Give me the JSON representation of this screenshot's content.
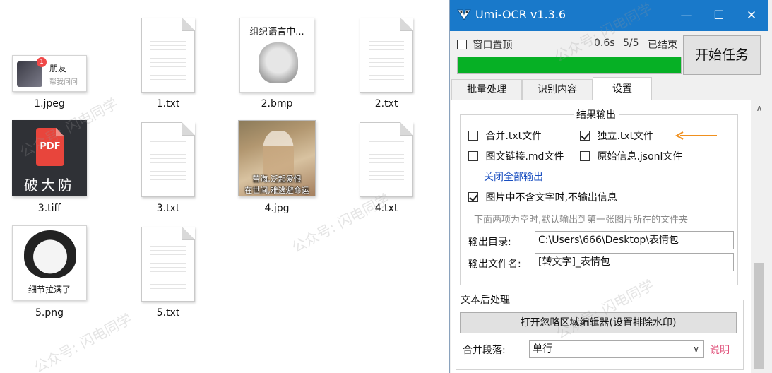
{
  "explorer": {
    "files": [
      {
        "name": "1.jpeg",
        "thumb_kind": "image",
        "thumb_text": "朋友",
        "thumb_subtext": "帮我问问",
        "badge": "1"
      },
      {
        "name": "1.txt",
        "thumb_kind": "text-document"
      },
      {
        "name": "2.bmp",
        "thumb_kind": "image",
        "thumb_text": "组织语言中..."
      },
      {
        "name": "2.txt",
        "thumb_kind": "text-document"
      },
      {
        "name": "3.tiff",
        "thumb_kind": "image",
        "thumb_badge": "PDF",
        "thumb_text": "破大防"
      },
      {
        "name": "3.txt",
        "thumb_kind": "text-document"
      },
      {
        "name": "4.jpg",
        "thumb_kind": "image",
        "thumb_text_1": "苦海,泛起爱恨",
        "thumb_text_2": "在世间,难逃避命运"
      },
      {
        "name": "4.txt",
        "thumb_kind": "text-document"
      },
      {
        "name": "5.png",
        "thumb_kind": "image",
        "thumb_text": "细节拉满了"
      },
      {
        "name": "5.txt",
        "thumb_kind": "text-document"
      }
    ],
    "watermark": "公众号: 闪电同学"
  },
  "ocr_window": {
    "title": "Umi-OCR v1.3.6",
    "controls": {
      "minimize": "—",
      "maximize": "☐",
      "close": "✕"
    },
    "topbar": {
      "pin_label": "窗口置顶",
      "pin_checked": false,
      "elapsed": "0.6s",
      "count": "5/5",
      "status": "已结束",
      "start_button": "开始任务",
      "progress": 1.0,
      "progress_color": "#06b025"
    },
    "tabs": [
      {
        "label": "批量处理",
        "active": false
      },
      {
        "label": "识别内容",
        "active": false
      },
      {
        "label": "设置",
        "active": true
      }
    ],
    "settings": {
      "result_output": {
        "legend": "结果输出",
        "merged_txt": {
          "label": "合并.txt文件",
          "checked": false
        },
        "separate_txt": {
          "label": "独立.txt文件",
          "checked": true
        },
        "md_link": {
          "label": "图文链接.md文件",
          "checked": false
        },
        "jsonl": {
          "label": "原始信息.jsonl文件",
          "checked": false
        },
        "close_all_link": "关闭全部输出",
        "skip_empty": {
          "label": "图片中不含文字时,不输出信息",
          "checked": true
        },
        "hint": "下面两项为空时,默认输出到第一张图片所在的文件夹",
        "output_dir_label": "输出目录:",
        "output_dir_value": "C:\\Users\\666\\Desktop\\表情包",
        "output_name_label": "输出文件名:",
        "output_name_value": "[转文字]_表情包",
        "arrow_color": "#f0901e"
      },
      "post_process": {
        "legend": "文本后处理",
        "overlay_button": "打开忽略区域编辑器(设置排除水印)",
        "merge_label": "合并段落:",
        "merge_value": "单行",
        "explain_link": "说明"
      }
    }
  }
}
